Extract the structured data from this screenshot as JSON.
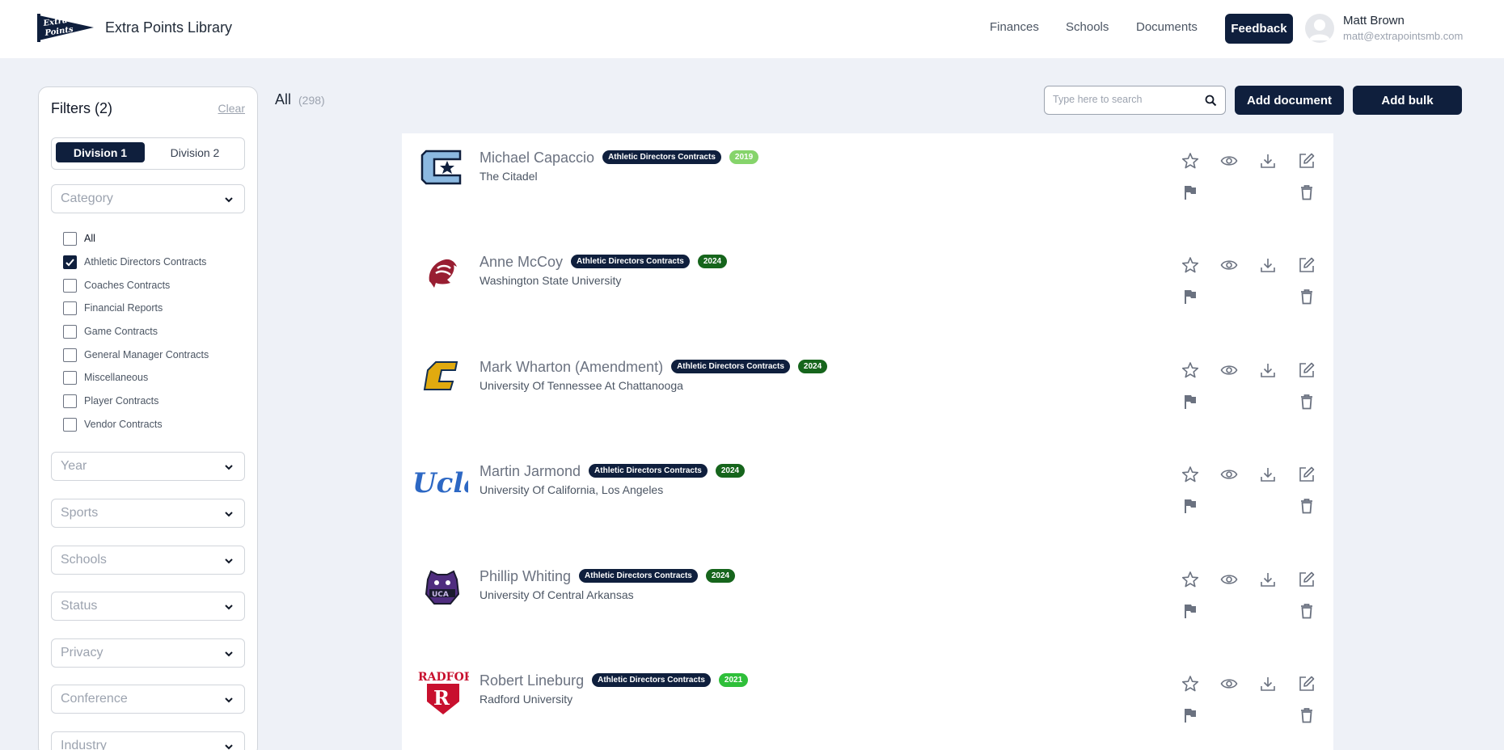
{
  "header": {
    "brand": "Extra Points Library",
    "logo_text": "Extra Points",
    "nav": [
      "Finances",
      "Schools",
      "Documents"
    ],
    "feedback_label": "Feedback",
    "user_name": "Matt Brown",
    "user_email": "matt@extrapointsmb.com"
  },
  "sidebar": {
    "title": "Filters (2)",
    "clear_label": "Clear",
    "divisions": [
      "Division 1",
      "Division 2"
    ],
    "active_division": "Division 1",
    "category_label": "Category",
    "categories": [
      {
        "label": "All",
        "checked": false
      },
      {
        "label": "Athletic Directors Contracts",
        "checked": true
      },
      {
        "label": "Coaches Contracts",
        "checked": false
      },
      {
        "label": "Financial Reports",
        "checked": false
      },
      {
        "label": "Game Contracts",
        "checked": false
      },
      {
        "label": "General Manager Contracts",
        "checked": false
      },
      {
        "label": "Miscellaneous",
        "checked": false
      },
      {
        "label": "Player Contracts",
        "checked": false
      },
      {
        "label": "Vendor Contracts",
        "checked": false
      }
    ],
    "filters": [
      "Year",
      "Sports",
      "Schools",
      "Status",
      "Privacy",
      "Conference",
      "Industry"
    ]
  },
  "toolbar": {
    "title": "All",
    "count": "(298)",
    "search_placeholder": "Type here to search",
    "add_document_label": "Add document",
    "add_bulk_label": "Add bulk"
  },
  "documents": [
    {
      "name": "Michael Capaccio",
      "category": "Athletic Directors Contracts",
      "year": "2019",
      "year_color": "#86d46b",
      "school": "The Citadel",
      "logo": "citadel-logo"
    },
    {
      "name": "Anne McCoy",
      "category": "Athletic Directors Contracts",
      "year": "2024",
      "year_color": "#16651c",
      "school": "Washington State University",
      "logo": "wsu-cougar-logo"
    },
    {
      "name": "Mark Wharton (Amendment)",
      "category": "Athletic Directors Contracts",
      "year": "2024",
      "year_color": "#16651c",
      "school": "University Of Tennessee At Chattanooga",
      "logo": "utc-logo"
    },
    {
      "name": "Martin Jarmond",
      "category": "Athletic Directors Contracts",
      "year": "2024",
      "year_color": "#16651c",
      "school": "University Of California, Los Angeles",
      "logo": "ucla-logo"
    },
    {
      "name": "Phillip Whiting",
      "category": "Athletic Directors Contracts",
      "year": "2024",
      "year_color": "#16651c",
      "school": "University Of Central Arkansas",
      "logo": "uca-bear-logo"
    },
    {
      "name": "Robert Lineburg",
      "category": "Athletic Directors Contracts",
      "year": "2021",
      "year_color": "#2fbf3a",
      "school": "Radford University",
      "logo": "radford-logo"
    }
  ],
  "colors": {
    "brand_dark": "#0f1f3d",
    "icon_gray": "#6b7280"
  },
  "icons": [
    "star-icon",
    "eye-icon",
    "download-icon",
    "edit-icon",
    "flag-icon",
    "trash-icon",
    "search-icon",
    "chevron-down-icon",
    "check-icon"
  ]
}
